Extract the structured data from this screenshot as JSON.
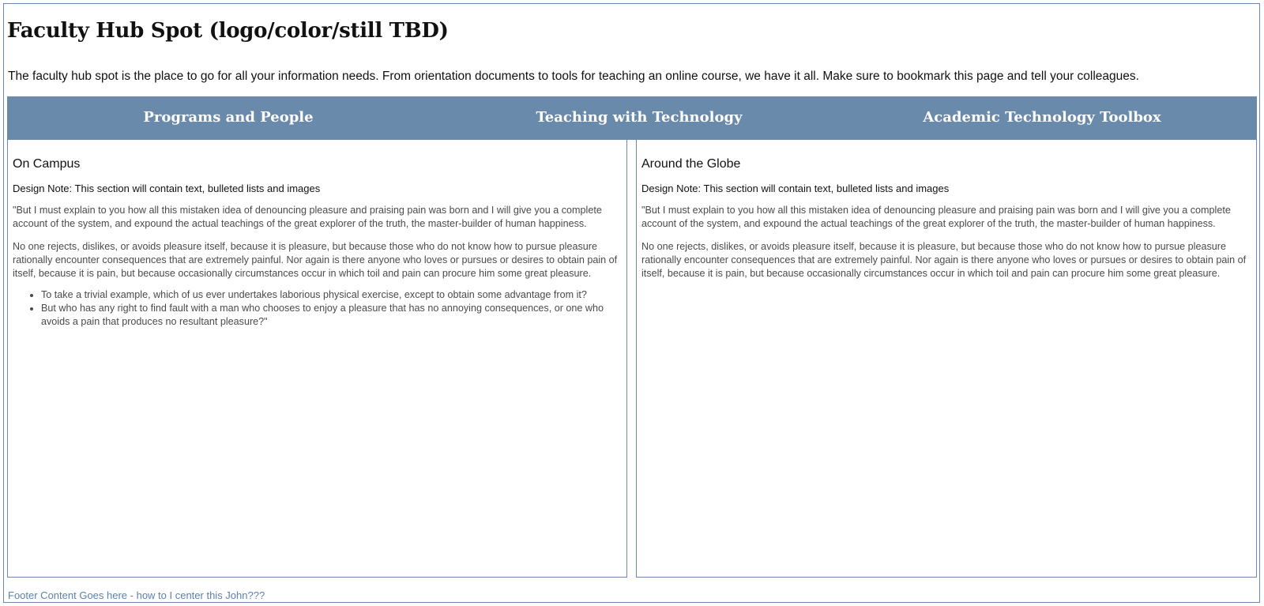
{
  "header": {
    "title": "Faculty Hub Spot (logo/color/still TBD)",
    "intro": "The faculty hub spot is the place to go for all your information needs. From orientation documents to tools for teaching an online course, we have it all. Make sure to bookmark this page and tell your colleagues."
  },
  "nav": {
    "items": [
      {
        "label": "Programs and People"
      },
      {
        "label": "Teaching with Technology"
      },
      {
        "label": "Academic Technology Toolbox"
      }
    ]
  },
  "panels": {
    "left": {
      "heading": "On Campus",
      "note": "Design Note: This section will contain text, bulleted lists and images",
      "paragraph1": "\"But I must explain to you how all this mistaken idea of denouncing pleasure and praising pain was born and I will give you a complete account of the system, and expound the actual teachings of the great explorer of the truth, the master-builder of human happiness.",
      "paragraph2": "No one rejects, dislikes, or avoids pleasure itself, because it is pleasure, but because those who do not know how to pursue pleasure rationally encounter consequences that are extremely painful. Nor again is there anyone who loves or pursues or desires to obtain pain of itself, because it is pain, but because occasionally circumstances occur in which toil and pain can procure him some great pleasure.",
      "bullets": [
        "To take a trivial example, which of us ever undertakes laborious physical exercise, except to obtain some advantage from it?",
        "But who has any right to find fault with a man who chooses to enjoy a pleasure that has no annoying consequences, or one who avoids a pain that produces no resultant pleasure?\""
      ]
    },
    "right": {
      "heading": "Around the Globe",
      "note": "Design Note: This section will contain text, bulleted lists and images",
      "paragraph1": "\"But I must explain to you how all this mistaken idea of denouncing pleasure and praising pain was born and I will give you a complete account of the system, and expound the actual teachings of the great explorer of the truth, the master-builder of human happiness.",
      "paragraph2": "No one rejects, dislikes, or avoids pleasure itself, because it is pleasure, but because those who do not know how to pursue pleasure rationally encounter consequences that are extremely painful. Nor again is there anyone who loves or pursues or desires to obtain pain of itself, because it is pain, but because occasionally circumstances occur in which toil and pain can procure him some great pleasure."
    }
  },
  "footer": {
    "text": "Footer Content Goes here - how to I center this John???"
  },
  "colors": {
    "nav_background": "#6a8aab",
    "border": "#6b8aab",
    "footer_text": "#5b82ad"
  }
}
